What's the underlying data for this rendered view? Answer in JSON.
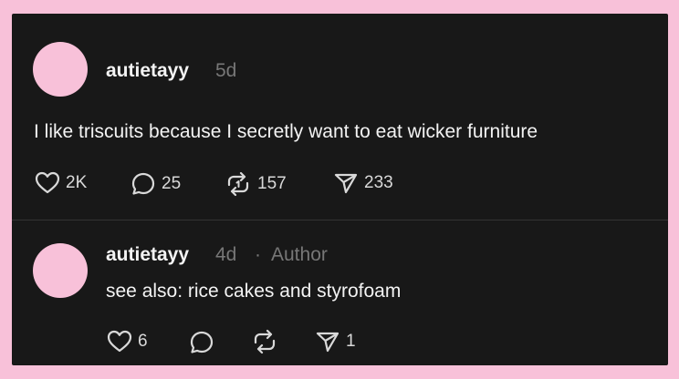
{
  "post": {
    "username": "autietayy",
    "time": "5d",
    "text": "I like triscuits because I secretly want to eat wicker furniture",
    "likes": "2K",
    "replies": "25",
    "reposts": "157",
    "shares": "233"
  },
  "reply": {
    "username": "autietayy",
    "time": "4d",
    "separator": "·",
    "badge": "Author",
    "text": "see also: rice cakes and styrofoam",
    "likes": "6",
    "shares": "1"
  },
  "colors": {
    "background": "#f8c1d9",
    "panel": "#181818",
    "avatar": "#f8c1d9",
    "text": "#f3f3f3",
    "muted": "#777777"
  },
  "icons": [
    "heart-icon",
    "comment-icon",
    "repost-icon",
    "share-icon"
  ]
}
